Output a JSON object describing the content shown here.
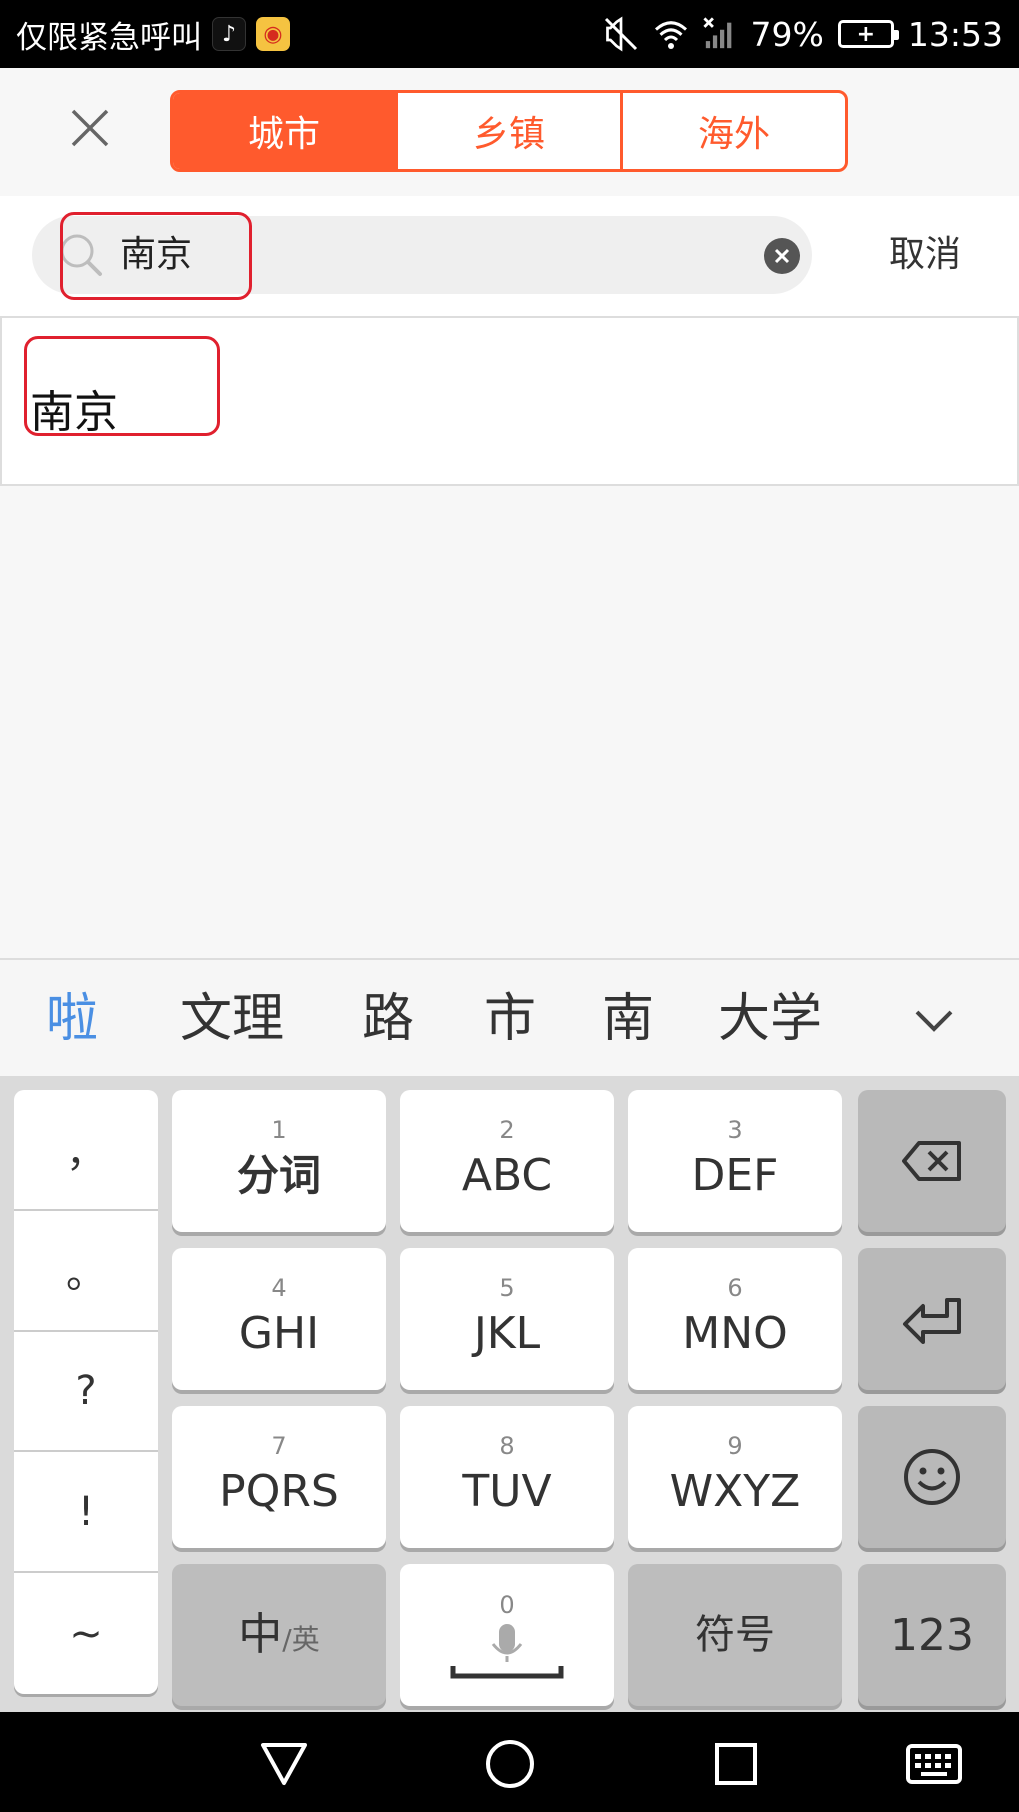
{
  "status_bar": {
    "carrier_text": "仅限紧急呼叫",
    "app_icons": [
      "tiktok-icon",
      "weibo-icon"
    ],
    "battery_percent": "79%",
    "time": "13:53"
  },
  "tabs": [
    {
      "label": "城市",
      "active": true
    },
    {
      "label": "乡镇",
      "active": false
    },
    {
      "label": "海外",
      "active": false
    }
  ],
  "search": {
    "value": "南京",
    "cancel_label": "取消"
  },
  "results": [
    {
      "label": "南京"
    }
  ],
  "candidates": [
    "啦",
    "文理",
    "路",
    "市",
    "南",
    "大学"
  ],
  "keyboard": {
    "punctuation": [
      "，",
      "。",
      "?",
      "!",
      "~"
    ],
    "keys": [
      {
        "num": "1",
        "label": "分词"
      },
      {
        "num": "2",
        "label": "ABC"
      },
      {
        "num": "3",
        "label": "DEF"
      },
      {
        "num": "4",
        "label": "GHI"
      },
      {
        "num": "5",
        "label": "JKL"
      },
      {
        "num": "6",
        "label": "MNO"
      },
      {
        "num": "7",
        "label": "PQRS"
      },
      {
        "num": "8",
        "label": "TUV"
      },
      {
        "num": "9",
        "label": "WXYZ"
      }
    ],
    "lang_main": "中",
    "lang_alt": "/英",
    "space_num": "0",
    "symbols_label": "符号",
    "numbers_label": "123"
  },
  "colors": {
    "accent": "#ff5a2d",
    "highlight": "#e0202e",
    "candidate_highlight": "#4a8fe3"
  }
}
